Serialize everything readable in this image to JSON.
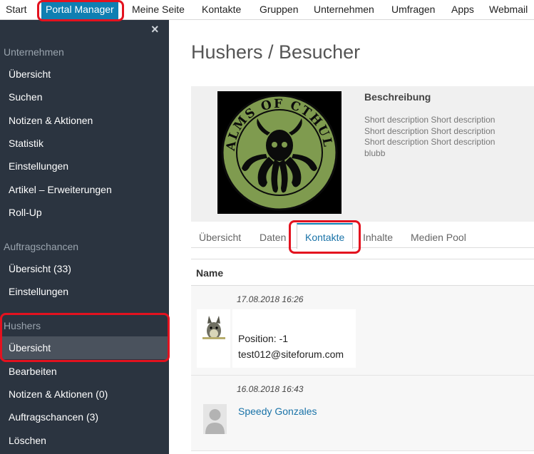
{
  "topnav": {
    "items": [
      "Start",
      "Portal Manager",
      "Meine Seite",
      "Kontakte",
      "Gruppen",
      "Unternehmen",
      "Umfragen",
      "Apps",
      "Webmail"
    ]
  },
  "sidebar": {
    "close_symbol": "×",
    "sections": [
      {
        "title": "Unternehmen",
        "items": [
          "Übersicht",
          "Suchen",
          "Notizen & Aktionen",
          "Statistik",
          "Einstellungen",
          "Artikel – Erweiterungen",
          "Roll-Up"
        ]
      },
      {
        "title": "Auftragschancen",
        "items": [
          "Übersicht (33)",
          "Einstellungen"
        ]
      },
      {
        "title": "Hushers",
        "items": [
          "Übersicht",
          "Bearbeiten",
          "Notizen & Aktionen (0)",
          "Auftragschancen (3)",
          "Löschen"
        ]
      }
    ],
    "selected": "Hushers/Übersicht"
  },
  "main": {
    "title": "Hushers / Besucher",
    "logo_text": "REALMS OF CTHULHU",
    "description_title": "Beschreibung",
    "description_text": "Short description Short description Short description Short description Short description Short description blubb",
    "tabs": [
      "Übersicht",
      "Daten",
      "Kontakte",
      "Inhalte",
      "Medien Pool"
    ],
    "active_tab": "Kontakte",
    "table_header": "Name",
    "entries": [
      {
        "date": "17.08.2018 16:26",
        "position": "Position: -1",
        "email": "test012@siteforum.com"
      },
      {
        "date": "16.08.2018 16:43",
        "name": "Speedy Gonzales"
      }
    ]
  },
  "colors": {
    "accent": "#0f7fb2",
    "sidebar_bg": "#2b3440",
    "highlight": "#e3121f",
    "link": "#1a73a8"
  }
}
